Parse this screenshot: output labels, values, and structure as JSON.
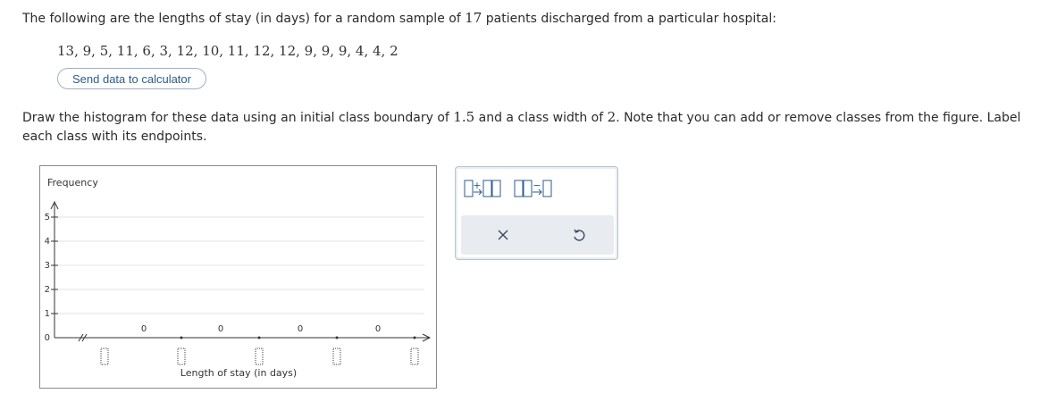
{
  "question": {
    "intro_part1": "The following are the lengths of stay (in days) for a random sample of ",
    "intro_n": "17",
    "intro_part2": " patients discharged from a particular hospital:",
    "data_values": "13, 9, 5, 11, 6, 3, 12, 10, 11, 12, 12, 9, 9, 9, 4, 4, 2",
    "send_button_label": "Send data to calculator",
    "instr_part1": "Draw the histogram for these data using an initial class boundary of ",
    "instr_boundary": "1.5",
    "instr_part2": " and a class width of ",
    "instr_width": "2",
    "instr_part3": ". Note that you can add or remove classes from the figure. Label each class with its endpoints."
  },
  "graph": {
    "y_axis_label": "Frequency",
    "x_axis_label": "Length of stay (in days)",
    "y_ticks": [
      "0",
      "1",
      "2",
      "3",
      "4",
      "5"
    ],
    "bar_frequencies": [
      "0",
      "0",
      "0",
      "0"
    ]
  },
  "tools": {
    "add_class_icon": "add-class-icon",
    "remove_class_icon": "remove-class-icon",
    "clear_icon": "x-icon",
    "undo_icon": "undo-icon"
  }
}
